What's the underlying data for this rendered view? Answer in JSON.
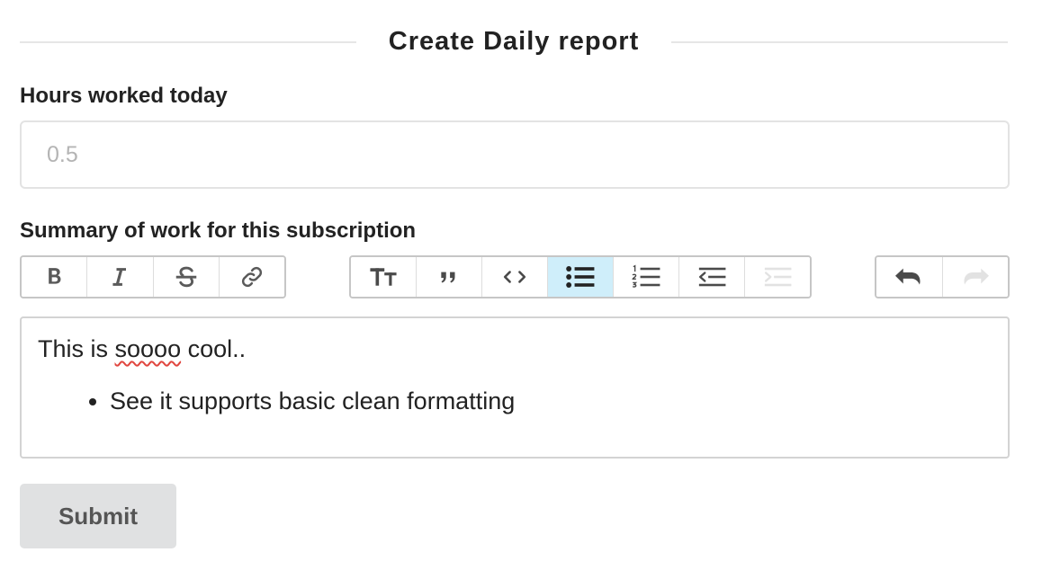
{
  "form": {
    "title": "Create Daily report",
    "submit_label": "Submit"
  },
  "hours": {
    "label": "Hours worked today",
    "value": "",
    "placeholder": "0.5"
  },
  "summary": {
    "label": "Summary of work for this subscription",
    "toolbar": {
      "groups": [
        [
          "bold-icon",
          "italic-icon",
          "strikethrough-icon",
          "link-icon"
        ],
        [
          "heading-icon",
          "quote-icon",
          "code-icon",
          "bullet-list-icon",
          "numbered-list-icon",
          "decrease-indent-icon",
          "increase-indent-icon"
        ],
        [
          "undo-icon",
          "redo-icon"
        ]
      ],
      "active_tool": "bullet-list-icon",
      "disabled_tools": [
        "increase-indent-icon",
        "redo-icon"
      ],
      "active_color": "#cfeefa"
    },
    "content": {
      "paragraph_before": "This is ",
      "misspelled_word": "soooo",
      "paragraph_after": " cool..",
      "bullets": [
        "See it supports basic clean formatting"
      ]
    }
  }
}
